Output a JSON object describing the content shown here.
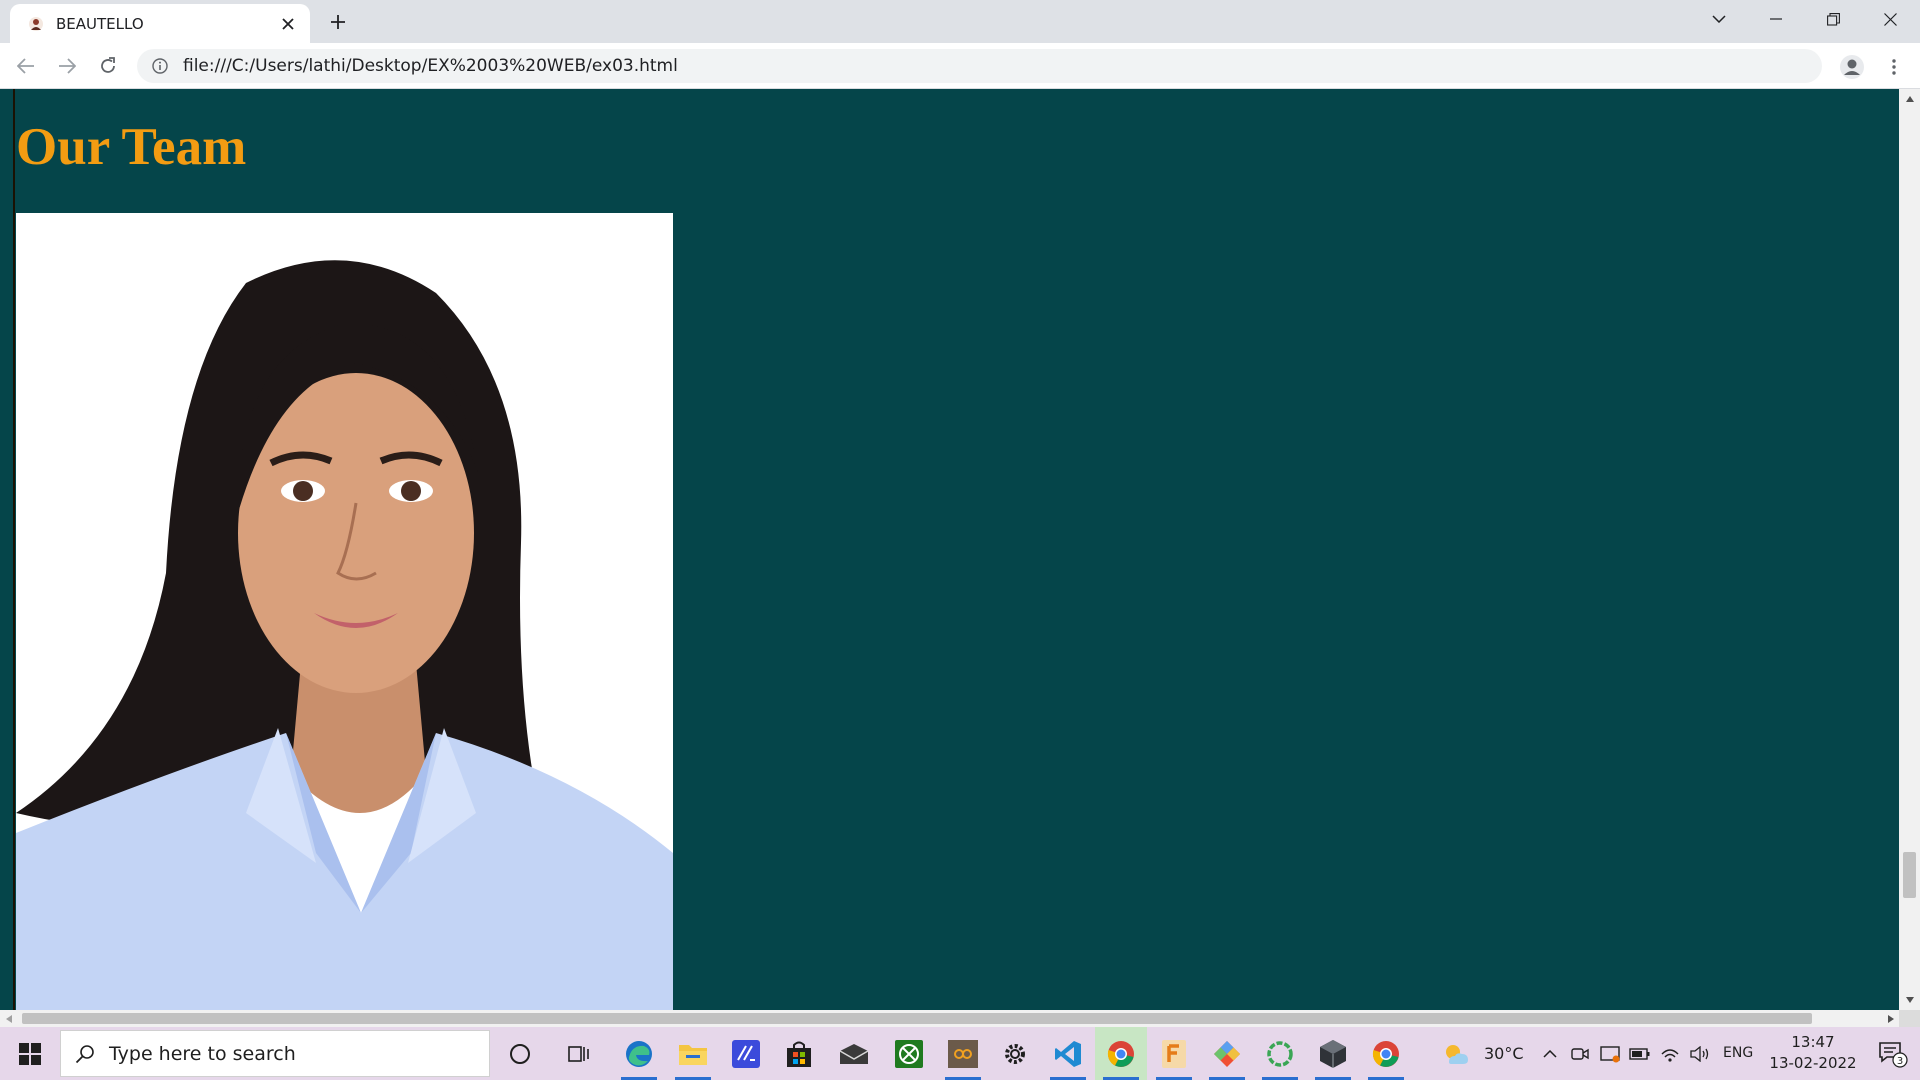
{
  "browser": {
    "tab_title": "BEAUTELLO",
    "url": "file:///C:/Users/lathi/Desktop/EX%2003%20WEB/ex03.html"
  },
  "page": {
    "heading": "Our Team",
    "background_color": "#05454a",
    "heading_color": "#f39c12",
    "image": "team-member-photo"
  },
  "taskbar": {
    "search_placeholder": "Type here to search",
    "pinned_apps": [
      "task-view-icon",
      "edge-icon",
      "file-explorer-icon",
      "visual-studio-icon",
      "store-icon",
      "mail-icon",
      "xbox-icon",
      "media-app-icon",
      "settings-icon",
      "vscode-icon",
      "chrome-icon",
      "sublime-icon",
      "git-icon",
      "cortana-ring-icon",
      "cube-app-icon",
      "chrome-icon"
    ],
    "weather": "30°C",
    "language": "ENG",
    "time": "13:47",
    "date": "13-02-2022",
    "notifications": "3"
  }
}
